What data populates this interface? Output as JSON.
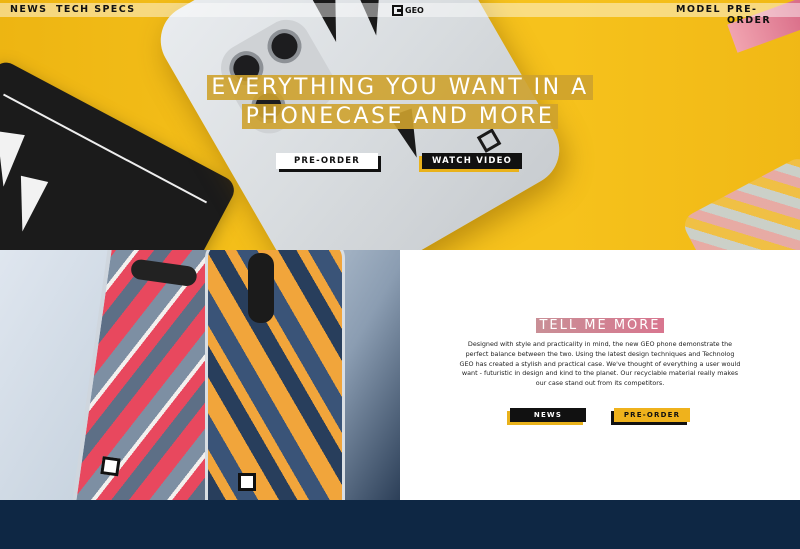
{
  "nav": {
    "left_items": [
      "NEWS",
      "TECH SPECS"
    ],
    "right_items": [
      "MODEL",
      "PRE-ORDER"
    ],
    "logo_text": "GEO"
  },
  "hero": {
    "headline_line1": "EVERYTHING YOU WANT IN A",
    "headline_line2": "PHONECASE AND MORE",
    "preorder_label": "PRE-ORDER",
    "watch_label": "WATCH VIDEO"
  },
  "feature": {
    "title": "TELL ME MORE",
    "body": "Designed with style and practicality in mind, the new GEO phone demonstrate the perfect balance between the two. Using the latest design techniques and Technolog GEO has created a stylish and practical case. We've thought of everything a user would want - futuristic in design and kind to the planet. Our recyclable material really makes our case stand out from its competitors.",
    "news_label": "NEWS",
    "preorder_label": "PRE-ORDER"
  },
  "colors": {
    "hero_yellow": "#f6c21c",
    "accent_yellow": "#efb21c",
    "footer_navy": "#0e2744",
    "title_pink": "#d8768f"
  }
}
